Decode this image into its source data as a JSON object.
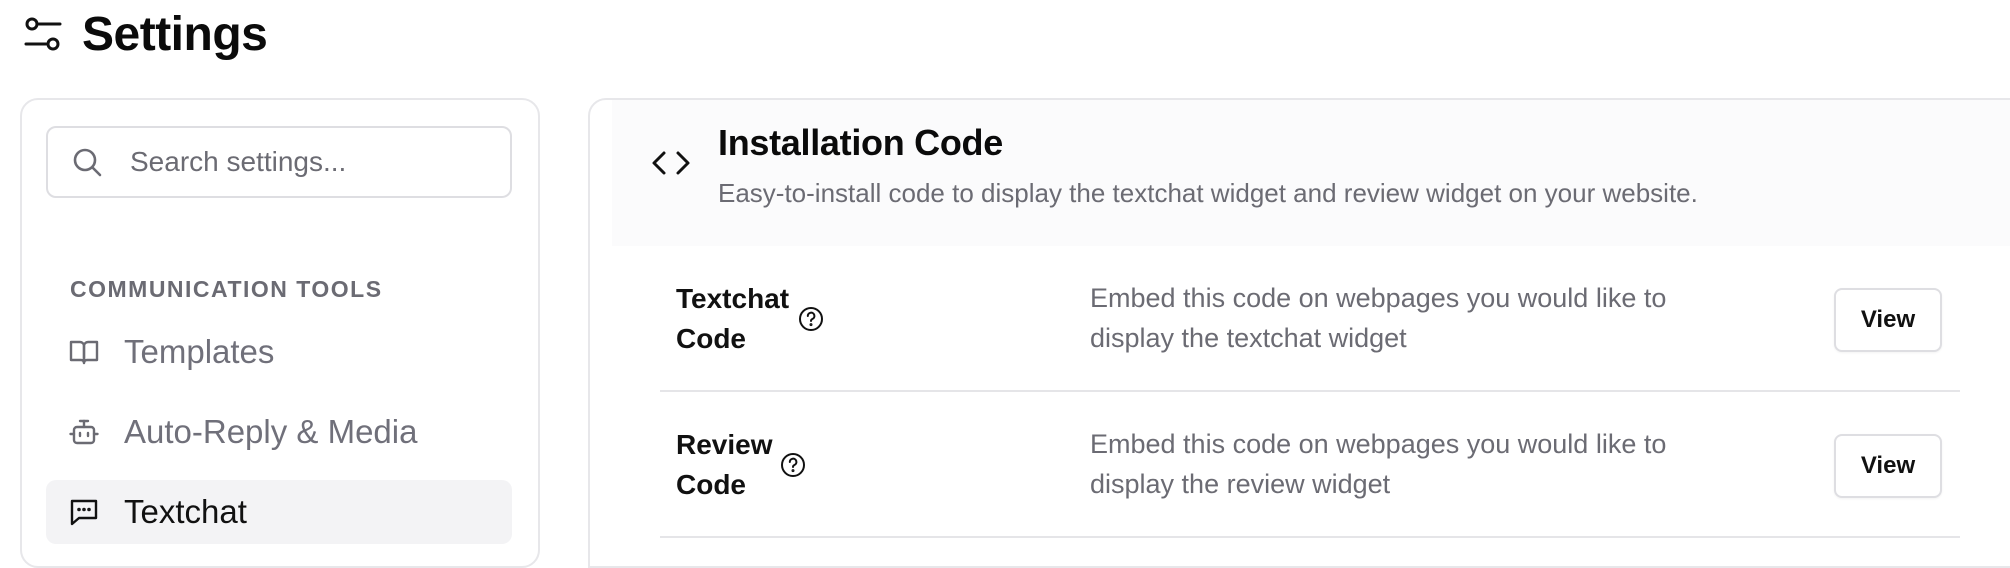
{
  "page": {
    "title": "Settings",
    "icon": "sliders-icon"
  },
  "sidebar": {
    "search": {
      "placeholder": "Search settings...",
      "value": "",
      "icon": "search-icon"
    },
    "section_label": "COMMUNICATION TOOLS",
    "items": [
      {
        "label": "Templates",
        "icon": "book-open-icon",
        "active": false
      },
      {
        "label": "Auto-Reply & Media",
        "icon": "bot-icon",
        "active": false
      },
      {
        "label": "Textchat",
        "icon": "message-square-icon",
        "active": true
      }
    ]
  },
  "content": {
    "icon": "code-icon",
    "title": "Installation Code",
    "description": "Easy-to-install code to display the textchat widget and review widget on your website.",
    "rows": [
      {
        "name_line1": "Textchat",
        "name_line2": "Code",
        "help_icon": "help-circle-icon",
        "desc_line1": "Embed this code on webpages you would like to",
        "desc_line2": "display the textchat widget",
        "button_label": "View"
      },
      {
        "name_line1": "Review",
        "name_line2": "Code",
        "help_icon": "help-circle-icon",
        "desc_line1": "Embed this code on webpages you would like to",
        "desc_line2": "display the review widget",
        "button_label": "View"
      }
    ]
  },
  "colors": {
    "active_nav_bg": "#f3f3f5",
    "muted_text": "#6b6b73",
    "border": "#e7e7ea"
  }
}
